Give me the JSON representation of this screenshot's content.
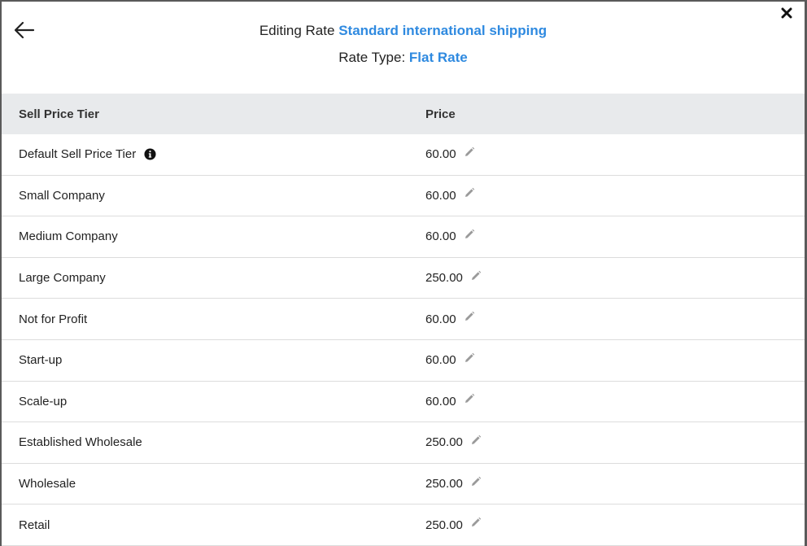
{
  "header": {
    "editing_prefix": "Editing Rate",
    "rate_name": "Standard international shipping",
    "rate_type_prefix": "Rate Type:",
    "rate_type": "Flat Rate"
  },
  "table": {
    "columns": [
      "Sell Price Tier",
      "Price"
    ],
    "rows": [
      {
        "tier": "Default Sell Price Tier",
        "price": "60.00",
        "info": true
      },
      {
        "tier": "Small Company",
        "price": "60.00"
      },
      {
        "tier": "Medium Company",
        "price": "60.00"
      },
      {
        "tier": "Large Company",
        "price": "250.00"
      },
      {
        "tier": "Not for Profit",
        "price": "60.00"
      },
      {
        "tier": "Start-up",
        "price": "60.00"
      },
      {
        "tier": "Scale-up",
        "price": "60.00"
      },
      {
        "tier": "Established Wholesale",
        "price": "250.00"
      },
      {
        "tier": "Wholesale",
        "price": "250.00"
      },
      {
        "tier": "Retail",
        "price": "250.00"
      }
    ]
  },
  "colors": {
    "accent": "#2f8ae0",
    "header_bg": "#e8eaec",
    "row_border": "#dcdcdc"
  },
  "icons": {
    "back": "arrow-left-icon",
    "close": "close-icon",
    "info": "info-icon",
    "edit": "pencil-icon"
  }
}
